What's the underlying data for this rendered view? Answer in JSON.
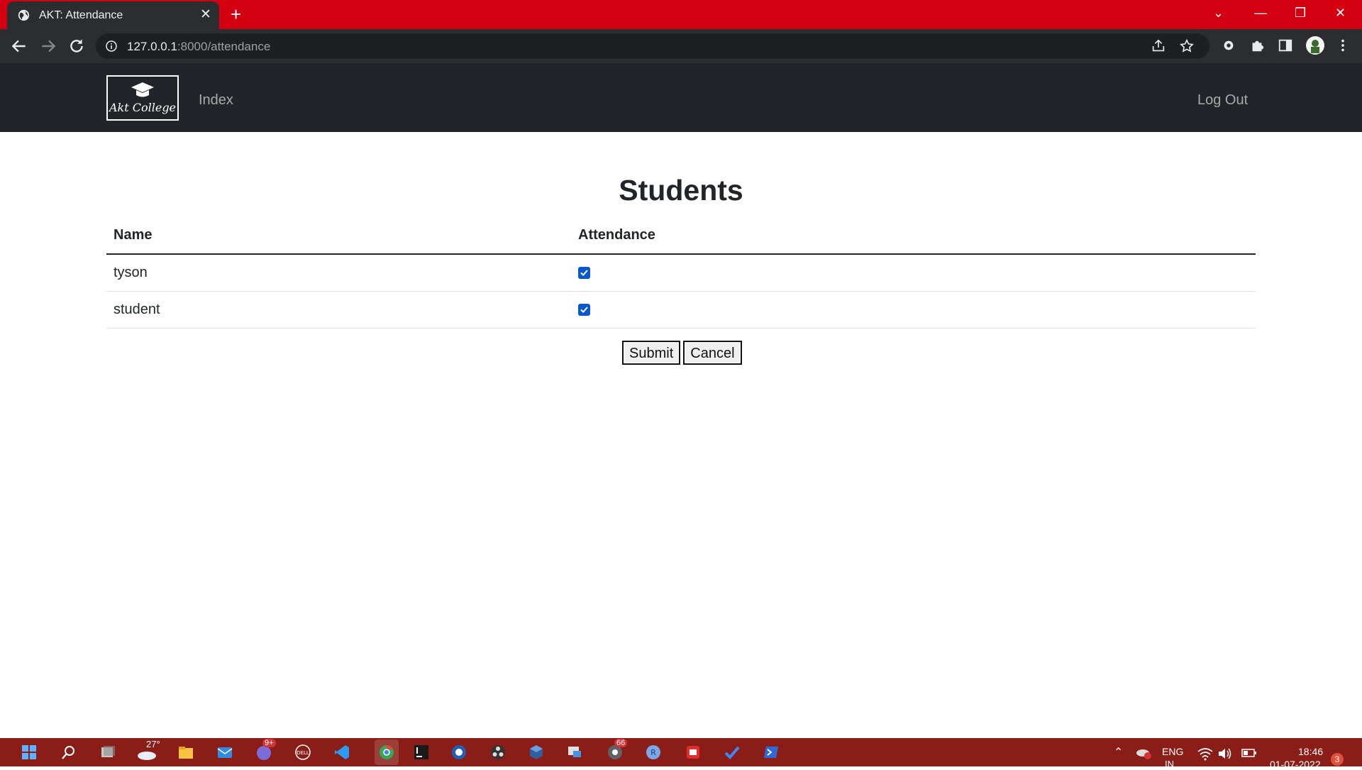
{
  "browser": {
    "tab_title": "AKT: Attendance",
    "url_host": "127.0.0.1",
    "url_rest": ":8000/attendance",
    "accent": "#d40012"
  },
  "navbar": {
    "logo_text": "Akt College",
    "links": [
      "Index"
    ],
    "logout": "Log Out"
  },
  "main": {
    "heading": "Students",
    "columns": [
      "Name",
      "Attendance"
    ],
    "rows": [
      {
        "name": "tyson",
        "present": true
      },
      {
        "name": "student",
        "present": true
      }
    ],
    "submit_label": "Submit",
    "cancel_label": "Cancel"
  },
  "taskbar": {
    "weather_temp": "27°",
    "chat_badge": "9+",
    "mail_badge": "66",
    "language": "ENG",
    "language_region": "IN",
    "time": "18:46",
    "date": "01-07-2022",
    "notification_count": "3",
    "apps": [
      "start-icon",
      "search-icon",
      "task-view-icon",
      "weather-icon",
      "file-explorer-icon",
      "mail-icon",
      "teams-chat-icon",
      "dell-icon",
      "vscode-icon",
      "chrome-icon",
      "intellij-icon",
      "app-icon",
      "obs-icon",
      "virtualbox-icon",
      "remote-desktop-icon",
      "chrome-dev-icon",
      "r-icon",
      "notes-icon",
      "todo-icon",
      "powershell-icon"
    ]
  }
}
